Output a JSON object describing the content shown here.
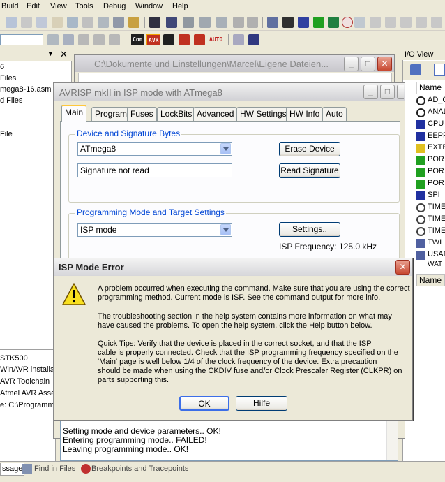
{
  "menubar": {
    "items": [
      "Build",
      "Edit",
      "View",
      "Tools",
      "Debug",
      "Window",
      "Help"
    ]
  },
  "toolbar2": {
    "labels": [
      "Con",
      "AVR",
      "AUTO"
    ]
  },
  "left_panel": {
    "items": [
      "6",
      "Files",
      "mega8-16.asm",
      "d Files",
      "File"
    ]
  },
  "left_bottom": {
    "items": [
      "STK500",
      "WinAVR installa",
      "AVR Toolchain",
      "Atmel AVR Asse",
      "e: C:\\Programme"
    ]
  },
  "right_panel": {
    "title": "I/O View",
    "col_header": "Name",
    "items": [
      "AD_C",
      "ANAL",
      "CPU",
      "EEPR",
      "EXTE",
      "POR",
      "POR",
      "POR",
      "SPI",
      "TIME",
      "TIME",
      "TIME",
      "TWI",
      "USAR",
      "WAT"
    ],
    "bottom_header": "Name"
  },
  "editor": {
    "title": "C:\\Dokumente und Einstellungen\\Marcel\\Eigene Dateien..."
  },
  "avr_dialog": {
    "title": "AVRISP mkII in ISP mode with ATmega8",
    "tabs": [
      "Main",
      "Program",
      "Fuses",
      "LockBits",
      "Advanced",
      "HW Settings",
      "HW Info",
      "Auto"
    ],
    "device_group_label": "Device and Signature Bytes",
    "device_value": "ATmega8",
    "signature_value": "Signature not read",
    "erase_button": "Erase Device",
    "read_sig_button": "Read Signature",
    "prog_group_label": "Programming Mode and Target Settings",
    "mode_value": "ISP mode",
    "settings_button": "Settings..",
    "isp_freq_label": "ISP Frequency:",
    "isp_freq_value": "125.0 kHz"
  },
  "error_dialog": {
    "title": "ISP Mode Error",
    "lines": [
      "A problem occurred when executing the command. Make sure that you are using the correct",
      "programming method. Current mode is ISP. See the command output for more info.",
      "The troubleshooting section in the help system contains more information on what may",
      "have caused the problems. To open the help system, click the Help button below.",
      "Quick Tips: Verify that the device is placed in the correct socket, and that the ISP",
      "cable is properly connected. Check that the ISP programming frequency specified on the",
      "'Main' page is well below 1/4 of the clock frequency of the device. Extra precaution",
      "should be made when using the CKDIV fuse and/or Clock Prescaler Register (CLKPR) on",
      "parts supporting this."
    ],
    "ok_button": "OK",
    "help_button": "Hilfe"
  },
  "output": {
    "lines": [
      "Setting mode and device parameters.. OK!",
      "Entering programming mode.. FAILED!",
      "Leaving programming mode.. OK!"
    ]
  },
  "statusbar": {
    "tabs": [
      "ssage",
      "Find in Files",
      "Breakpoints and Tracepoints"
    ]
  }
}
